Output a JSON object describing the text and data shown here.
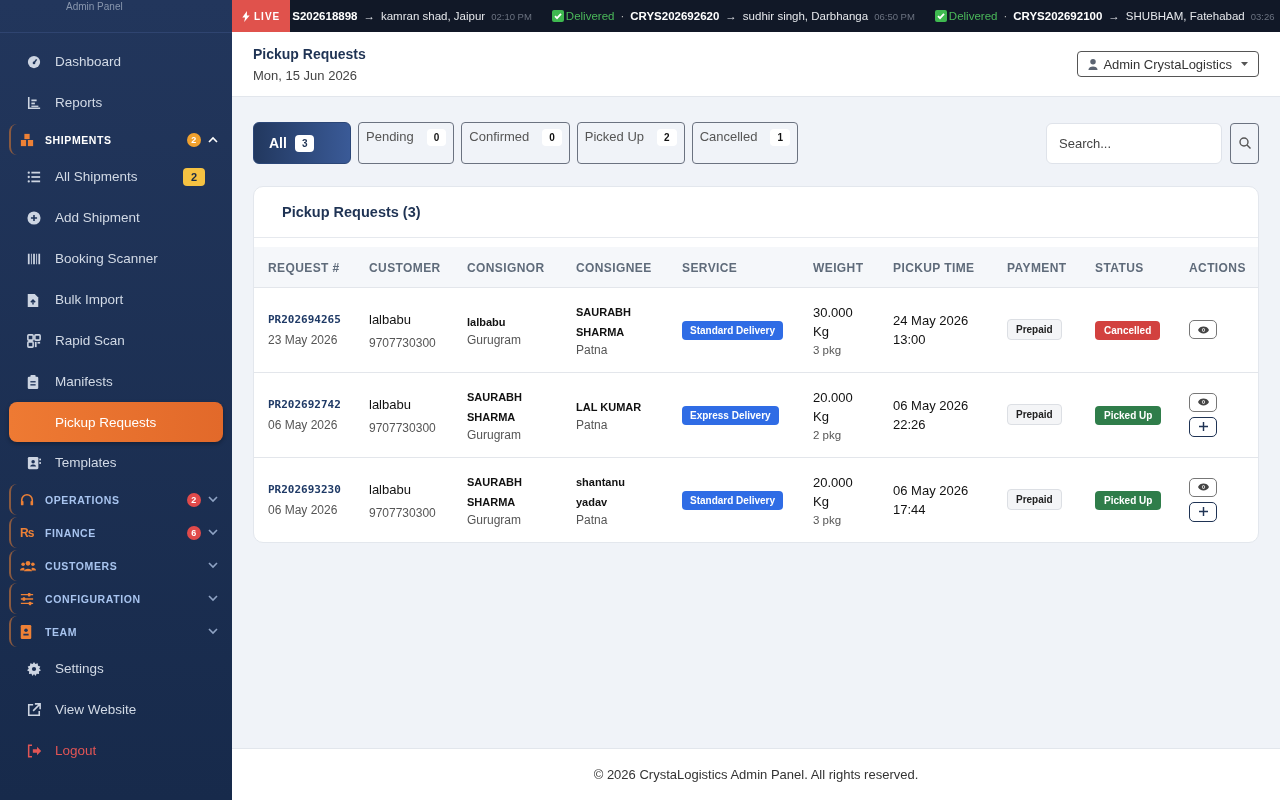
{
  "sidebar": {
    "subtitle": "Admin Panel",
    "items": [
      {
        "kind": "link",
        "label": "Dashboard",
        "selected": false
      },
      {
        "kind": "link",
        "label": "Reports",
        "selected": false
      },
      {
        "kind": "group",
        "label": "SHIPMENTS",
        "expanded": true,
        "badge": "2",
        "color": "#f0a12e",
        "children": [
          {
            "label": "All Shipments",
            "badge": "2",
            "selected": false
          },
          {
            "label": "Add Shipment",
            "selected": false
          },
          {
            "label": "Booking Scanner",
            "selected": false
          },
          {
            "label": "Bulk Import",
            "selected": false
          },
          {
            "label": "Rapid Scan",
            "selected": false
          },
          {
            "label": "Manifests",
            "selected": false
          },
          {
            "label": "Pickup Requests",
            "selected": true
          },
          {
            "label": "Templates",
            "selected": false
          }
        ]
      },
      {
        "kind": "group",
        "label": "OPERATIONS",
        "expanded": false,
        "badge": "2",
        "color": "#e04a4a"
      },
      {
        "kind": "group",
        "label": "FINANCE",
        "icon_text": "Rs",
        "expanded": false,
        "badge": "6",
        "color": "#e04a4a"
      },
      {
        "kind": "group",
        "label": "CUSTOMERS",
        "expanded": false
      },
      {
        "kind": "group",
        "label": "CONFIGURATION",
        "expanded": false
      },
      {
        "kind": "group",
        "label": "TEAM",
        "expanded": false
      },
      {
        "kind": "link",
        "label": "Settings",
        "selected": false
      },
      {
        "kind": "link",
        "label": "View Website",
        "selected": false
      },
      {
        "kind": "logout",
        "label": "Logout",
        "selected": false
      }
    ]
  },
  "ticker": {
    "badge": "LIVE",
    "items": [
      {
        "id": "S202618898",
        "arrow": "→",
        "destination": "kamran shad, Jaipur",
        "time": "02:10 PM"
      },
      {
        "status": "Delivered",
        "separator": "·",
        "id": "CRYS202692620",
        "arrow": "→",
        "destination": "sudhir singh, Darbhanga",
        "time": "06:50 PM"
      },
      {
        "status": "Delivered",
        "separator": "·",
        "id": "CRYS202692100",
        "arrow": "→",
        "destination": "SHUBHAM, Fatehabad",
        "time": "03:26"
      }
    ]
  },
  "header": {
    "title": "Pickup Requests",
    "date": "Mon, 15 Jun 2026",
    "user": "Admin CrystaLogistics"
  },
  "filters": [
    {
      "label": "All",
      "count": "3",
      "selected": true
    },
    {
      "label": "Pending",
      "count": "0",
      "selected": false
    },
    {
      "label": "Confirmed",
      "count": "0",
      "selected": false
    },
    {
      "label": "Picked Up",
      "count": "2",
      "selected": false
    },
    {
      "label": "Cancelled",
      "count": "1",
      "selected": false
    }
  ],
  "search": {
    "placeholder": "Search..."
  },
  "table": {
    "title": "Pickup Requests (3)",
    "columns": [
      "REQUEST #",
      "CUSTOMER",
      "CONSIGNOR",
      "CONSIGNEE",
      "SERVICE",
      "WEIGHT",
      "PICKUP TIME",
      "PAYMENT",
      "STATUS",
      "ACTIONS"
    ],
    "rows": [
      {
        "request": "PR202694265",
        "request_date": "23 May 2026",
        "customer": "lalbabu",
        "phone": "9707730300",
        "consignor": "lalbabu",
        "consignor_city": "Gurugram",
        "consignee": "SAURABH SHARMA",
        "consignee_city": "Patna",
        "service": "Standard Delivery",
        "weight": "30.000 Kg",
        "packages": "3 pkg",
        "pickup_date": "24 May 2026",
        "pickup_time": "13:00",
        "payment": "Prepaid",
        "status": {
          "kind": "cancelled",
          "label": "Cancelled"
        },
        "actions": [
          {
            "kind": "view"
          }
        ]
      },
      {
        "request": "PR202692742",
        "request_date": "06 May 2026",
        "customer": "lalbabu",
        "phone": "9707730300",
        "consignor": "SAURABH SHARMA",
        "consignor_city": "Gurugram",
        "consignee": "LAL KUMAR",
        "consignee_city": "Patna",
        "service": "Express Delivery",
        "weight": "20.000 Kg",
        "packages": "2 pkg",
        "pickup_date": "06 May 2026",
        "pickup_time": "22:26",
        "payment": "Prepaid",
        "status": {
          "kind": "picked_up",
          "label": "Picked Up"
        },
        "actions": [
          {
            "kind": "view"
          },
          {
            "kind": "add"
          }
        ]
      },
      {
        "request": "PR202693230",
        "request_date": "06 May 2026",
        "customer": "lalbabu",
        "phone": "9707730300",
        "consignor": "SAURABH SHARMA",
        "consignor_city": "Gurugram",
        "consignee": "shantanu yadav",
        "consignee_city": "Patna",
        "service": "Standard Delivery",
        "weight": "20.000 Kg",
        "packages": "3 pkg",
        "pickup_date": "06 May 2026",
        "pickup_time": "17:44",
        "payment": "Prepaid",
        "status": {
          "kind": "picked_up",
          "label": "Picked Up"
        },
        "actions": [
          {
            "kind": "view"
          },
          {
            "kind": "add"
          }
        ]
      }
    ]
  },
  "footer": "© 2026 CrystaLogistics Admin Panel. All rights reserved."
}
